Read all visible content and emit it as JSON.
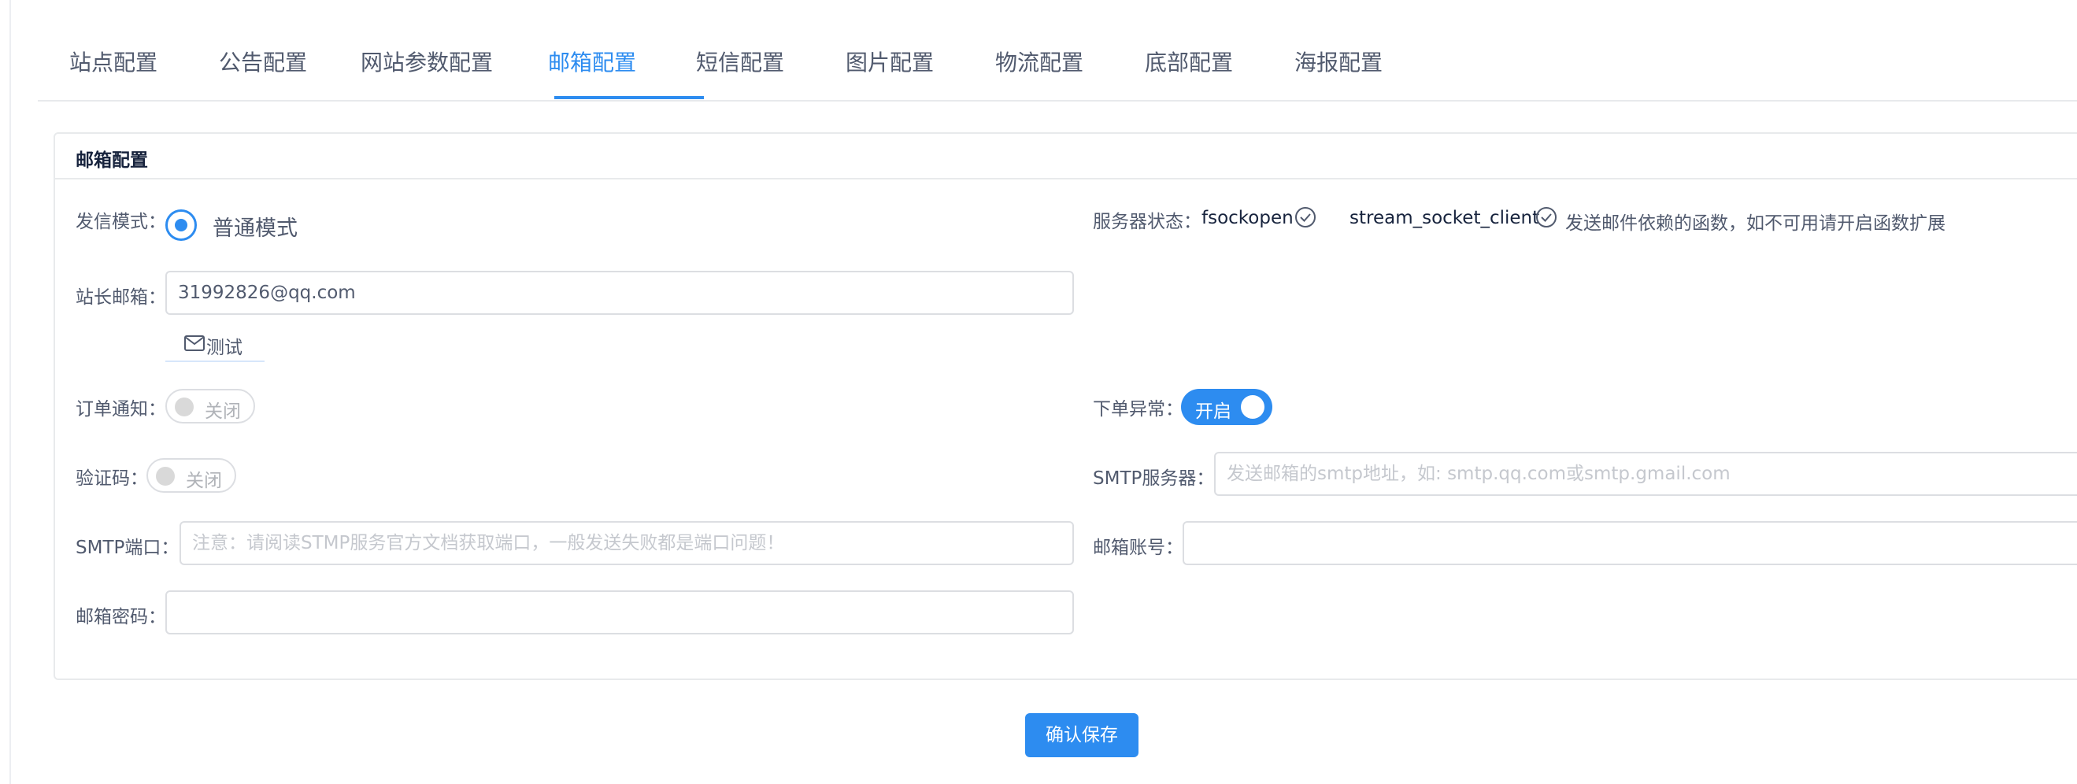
{
  "tabs": [
    {
      "label": "站点配置"
    },
    {
      "label": "公告配置"
    },
    {
      "label": "网站参数配置"
    },
    {
      "label": "邮箱配置"
    },
    {
      "label": "短信配置"
    },
    {
      "label": "图片配置"
    },
    {
      "label": "物流配置"
    },
    {
      "label": "底部配置"
    },
    {
      "label": "海报配置"
    }
  ],
  "active_tab": "邮箱配置",
  "card": {
    "title": "邮箱配置"
  },
  "form": {
    "send_mode": {
      "label": "发信模式：",
      "option": "普通模式",
      "selected": true
    },
    "server_status": {
      "label": "服务器状态：",
      "fn1": "fsockopen",
      "fn2": "stream_socket_client",
      "hint": "发送邮件依赖的函数，如不可用请开启函数扩展"
    },
    "admin_email": {
      "label": "站长邮箱：",
      "value": "31992826@qq.com"
    },
    "test_button": {
      "label": "测试"
    },
    "order_notify": {
      "label": "订单通知：",
      "state": "关闭"
    },
    "order_exception": {
      "label": "下单异常：",
      "state": "开启"
    },
    "captcha": {
      "label": "验证码：",
      "state": "关闭"
    },
    "smtp_server": {
      "label": "SMTP服务器：",
      "placeholder": "发送邮箱的smtp地址，如: smtp.qq.com或smtp.gmail.com"
    },
    "smtp_port": {
      "label": "SMTP端口：",
      "placeholder": "注意：请阅读STMP服务官方文档获取端口，一般发送失败都是端口问题！"
    },
    "mail_account": {
      "label": "邮箱账号："
    },
    "mail_password": {
      "label": "邮箱密码："
    }
  },
  "save_button": {
    "label": "确认保存"
  },
  "colors": {
    "accent": "#2d8cf0",
    "border": "#dcdee2",
    "text": "#515a6e"
  }
}
